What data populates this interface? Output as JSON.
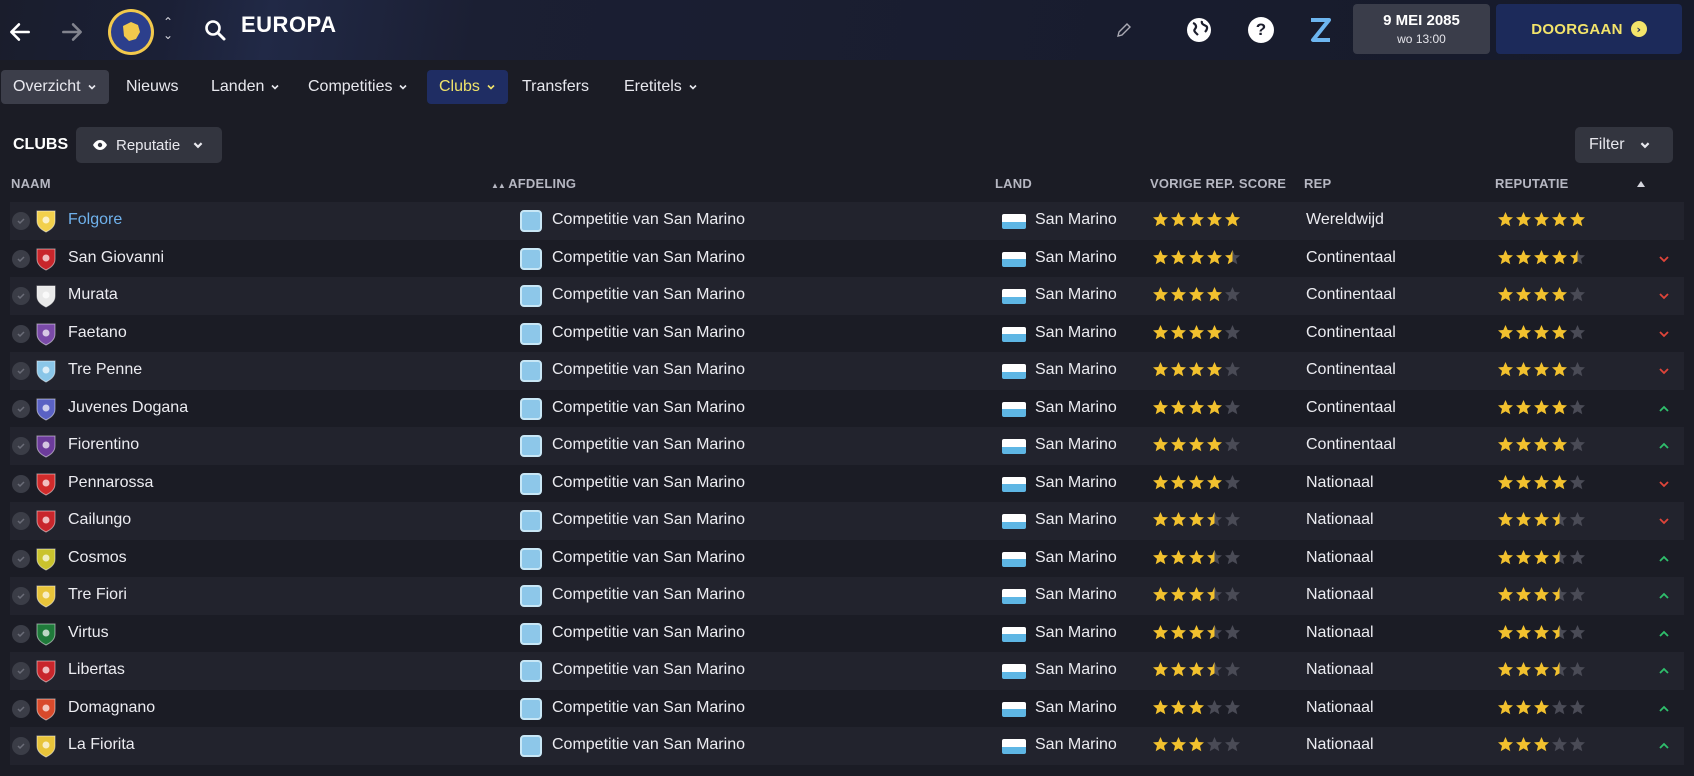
{
  "header": {
    "title": "EUROPA",
    "date": "9 MEI 2085",
    "time": "wo 13:00",
    "continue_label": "DOORGAAN",
    "help_glyph": "?"
  },
  "subnav": {
    "tabs": [
      {
        "label": "Overzicht",
        "dropdown": true
      },
      {
        "label": "Nieuws",
        "dropdown": false
      },
      {
        "label": "Landen",
        "dropdown": true
      },
      {
        "label": "Competities",
        "dropdown": true
      },
      {
        "label": "Clubs",
        "dropdown": true
      },
      {
        "label": "Transfers",
        "dropdown": false
      },
      {
        "label": "Eretitels",
        "dropdown": true
      }
    ]
  },
  "content": {
    "section_title": "CLUBS",
    "view_dropdown": "Reputatie",
    "filter_label": "Filter"
  },
  "table": {
    "headers": {
      "name": "NAAM",
      "division": "AFDELING",
      "country": "LAND",
      "prev_rep": "VORIGE REP. SCORE",
      "rep": "REP",
      "reputation": "REPUTATIE"
    },
    "rows": [
      {
        "name": "Folgore",
        "division": "Competitie van San Marino",
        "country": "San Marino",
        "prev_stars": 5,
        "rep": "Wereldwijd",
        "stars": 5,
        "trend": "none",
        "highlight": true,
        "crest": "#f2d04c"
      },
      {
        "name": "San Giovanni",
        "division": "Competitie van San Marino",
        "country": "San Marino",
        "prev_stars": 4.5,
        "rep": "Continentaal",
        "stars": 4.5,
        "trend": "down",
        "highlight": false,
        "crest": "#c8262b"
      },
      {
        "name": "Murata",
        "division": "Competitie van San Marino",
        "country": "San Marino",
        "prev_stars": 4,
        "rep": "Continentaal",
        "stars": 4,
        "trend": "down",
        "highlight": false,
        "crest": "#e9e9e9"
      },
      {
        "name": "Faetano",
        "division": "Competitie van San Marino",
        "country": "San Marino",
        "prev_stars": 4,
        "rep": "Continentaal",
        "stars": 4,
        "trend": "down",
        "highlight": false,
        "crest": "#7a4aa8"
      },
      {
        "name": "Tre Penne",
        "division": "Competitie van San Marino",
        "country": "San Marino",
        "prev_stars": 4,
        "rep": "Continentaal",
        "stars": 4,
        "trend": "down",
        "highlight": false,
        "crest": "#8ac6e8"
      },
      {
        "name": "Juvenes Dogana",
        "division": "Competitie van San Marino",
        "country": "San Marino",
        "prev_stars": 4,
        "rep": "Continentaal",
        "stars": 4,
        "trend": "up",
        "highlight": false,
        "crest": "#5a62c4"
      },
      {
        "name": "Fiorentino",
        "division": "Competitie van San Marino",
        "country": "San Marino",
        "prev_stars": 4,
        "rep": "Continentaal",
        "stars": 4,
        "trend": "up",
        "highlight": false,
        "crest": "#6c3b9b"
      },
      {
        "name": "Pennarossa",
        "division": "Competitie van San Marino",
        "country": "San Marino",
        "prev_stars": 4,
        "rep": "Nationaal",
        "stars": 4,
        "trend": "down",
        "highlight": false,
        "crest": "#d12b2b"
      },
      {
        "name": "Cailungo",
        "division": "Competitie van San Marino",
        "country": "San Marino",
        "prev_stars": 3.5,
        "rep": "Nationaal",
        "stars": 3.5,
        "trend": "down",
        "highlight": false,
        "crest": "#c8262b"
      },
      {
        "name": "Cosmos",
        "division": "Competitie van San Marino",
        "country": "San Marino",
        "prev_stars": 3.5,
        "rep": "Nationaal",
        "stars": 3.5,
        "trend": "up",
        "highlight": false,
        "crest": "#c9c22d"
      },
      {
        "name": "Tre Fiori",
        "division": "Competitie van San Marino",
        "country": "San Marino",
        "prev_stars": 3.5,
        "rep": "Nationaal",
        "stars": 3.5,
        "trend": "up",
        "highlight": false,
        "crest": "#e8c43a"
      },
      {
        "name": "Virtus",
        "division": "Competitie van San Marino",
        "country": "San Marino",
        "prev_stars": 3.5,
        "rep": "Nationaal",
        "stars": 3.5,
        "trend": "up",
        "highlight": false,
        "crest": "#1f7a3a"
      },
      {
        "name": "Libertas",
        "division": "Competitie van San Marino",
        "country": "San Marino",
        "prev_stars": 3.5,
        "rep": "Nationaal",
        "stars": 3.5,
        "trend": "up",
        "highlight": false,
        "crest": "#c8262b"
      },
      {
        "name": "Domagnano",
        "division": "Competitie van San Marino",
        "country": "San Marino",
        "prev_stars": 3,
        "rep": "Nationaal",
        "stars": 3,
        "trend": "up",
        "highlight": false,
        "crest": "#d84a2b"
      },
      {
        "name": "La Fiorita",
        "division": "Competitie van San Marino",
        "country": "San Marino",
        "prev_stars": 3,
        "rep": "Nationaal",
        "stars": 3,
        "trend": "up",
        "highlight": false,
        "crest": "#e8c43a"
      }
    ]
  },
  "colors": {
    "star_filled": "#f2c12e",
    "star_empty": "#4a4b56",
    "trend_up": "#2fbf6c",
    "trend_down": "#e0453a",
    "accent_yellow": "#f3e46a",
    "link_blue": "#6fb1ec"
  },
  "icons": [
    "back-arrow-icon",
    "forward-arrow-icon",
    "europe-logo-icon",
    "switcher-icon",
    "search-icon",
    "pencil-icon",
    "globe-icon",
    "help-icon",
    "z-icon",
    "eye-icon",
    "chevron-down-icon",
    "check-icon",
    "sort-icon"
  ]
}
